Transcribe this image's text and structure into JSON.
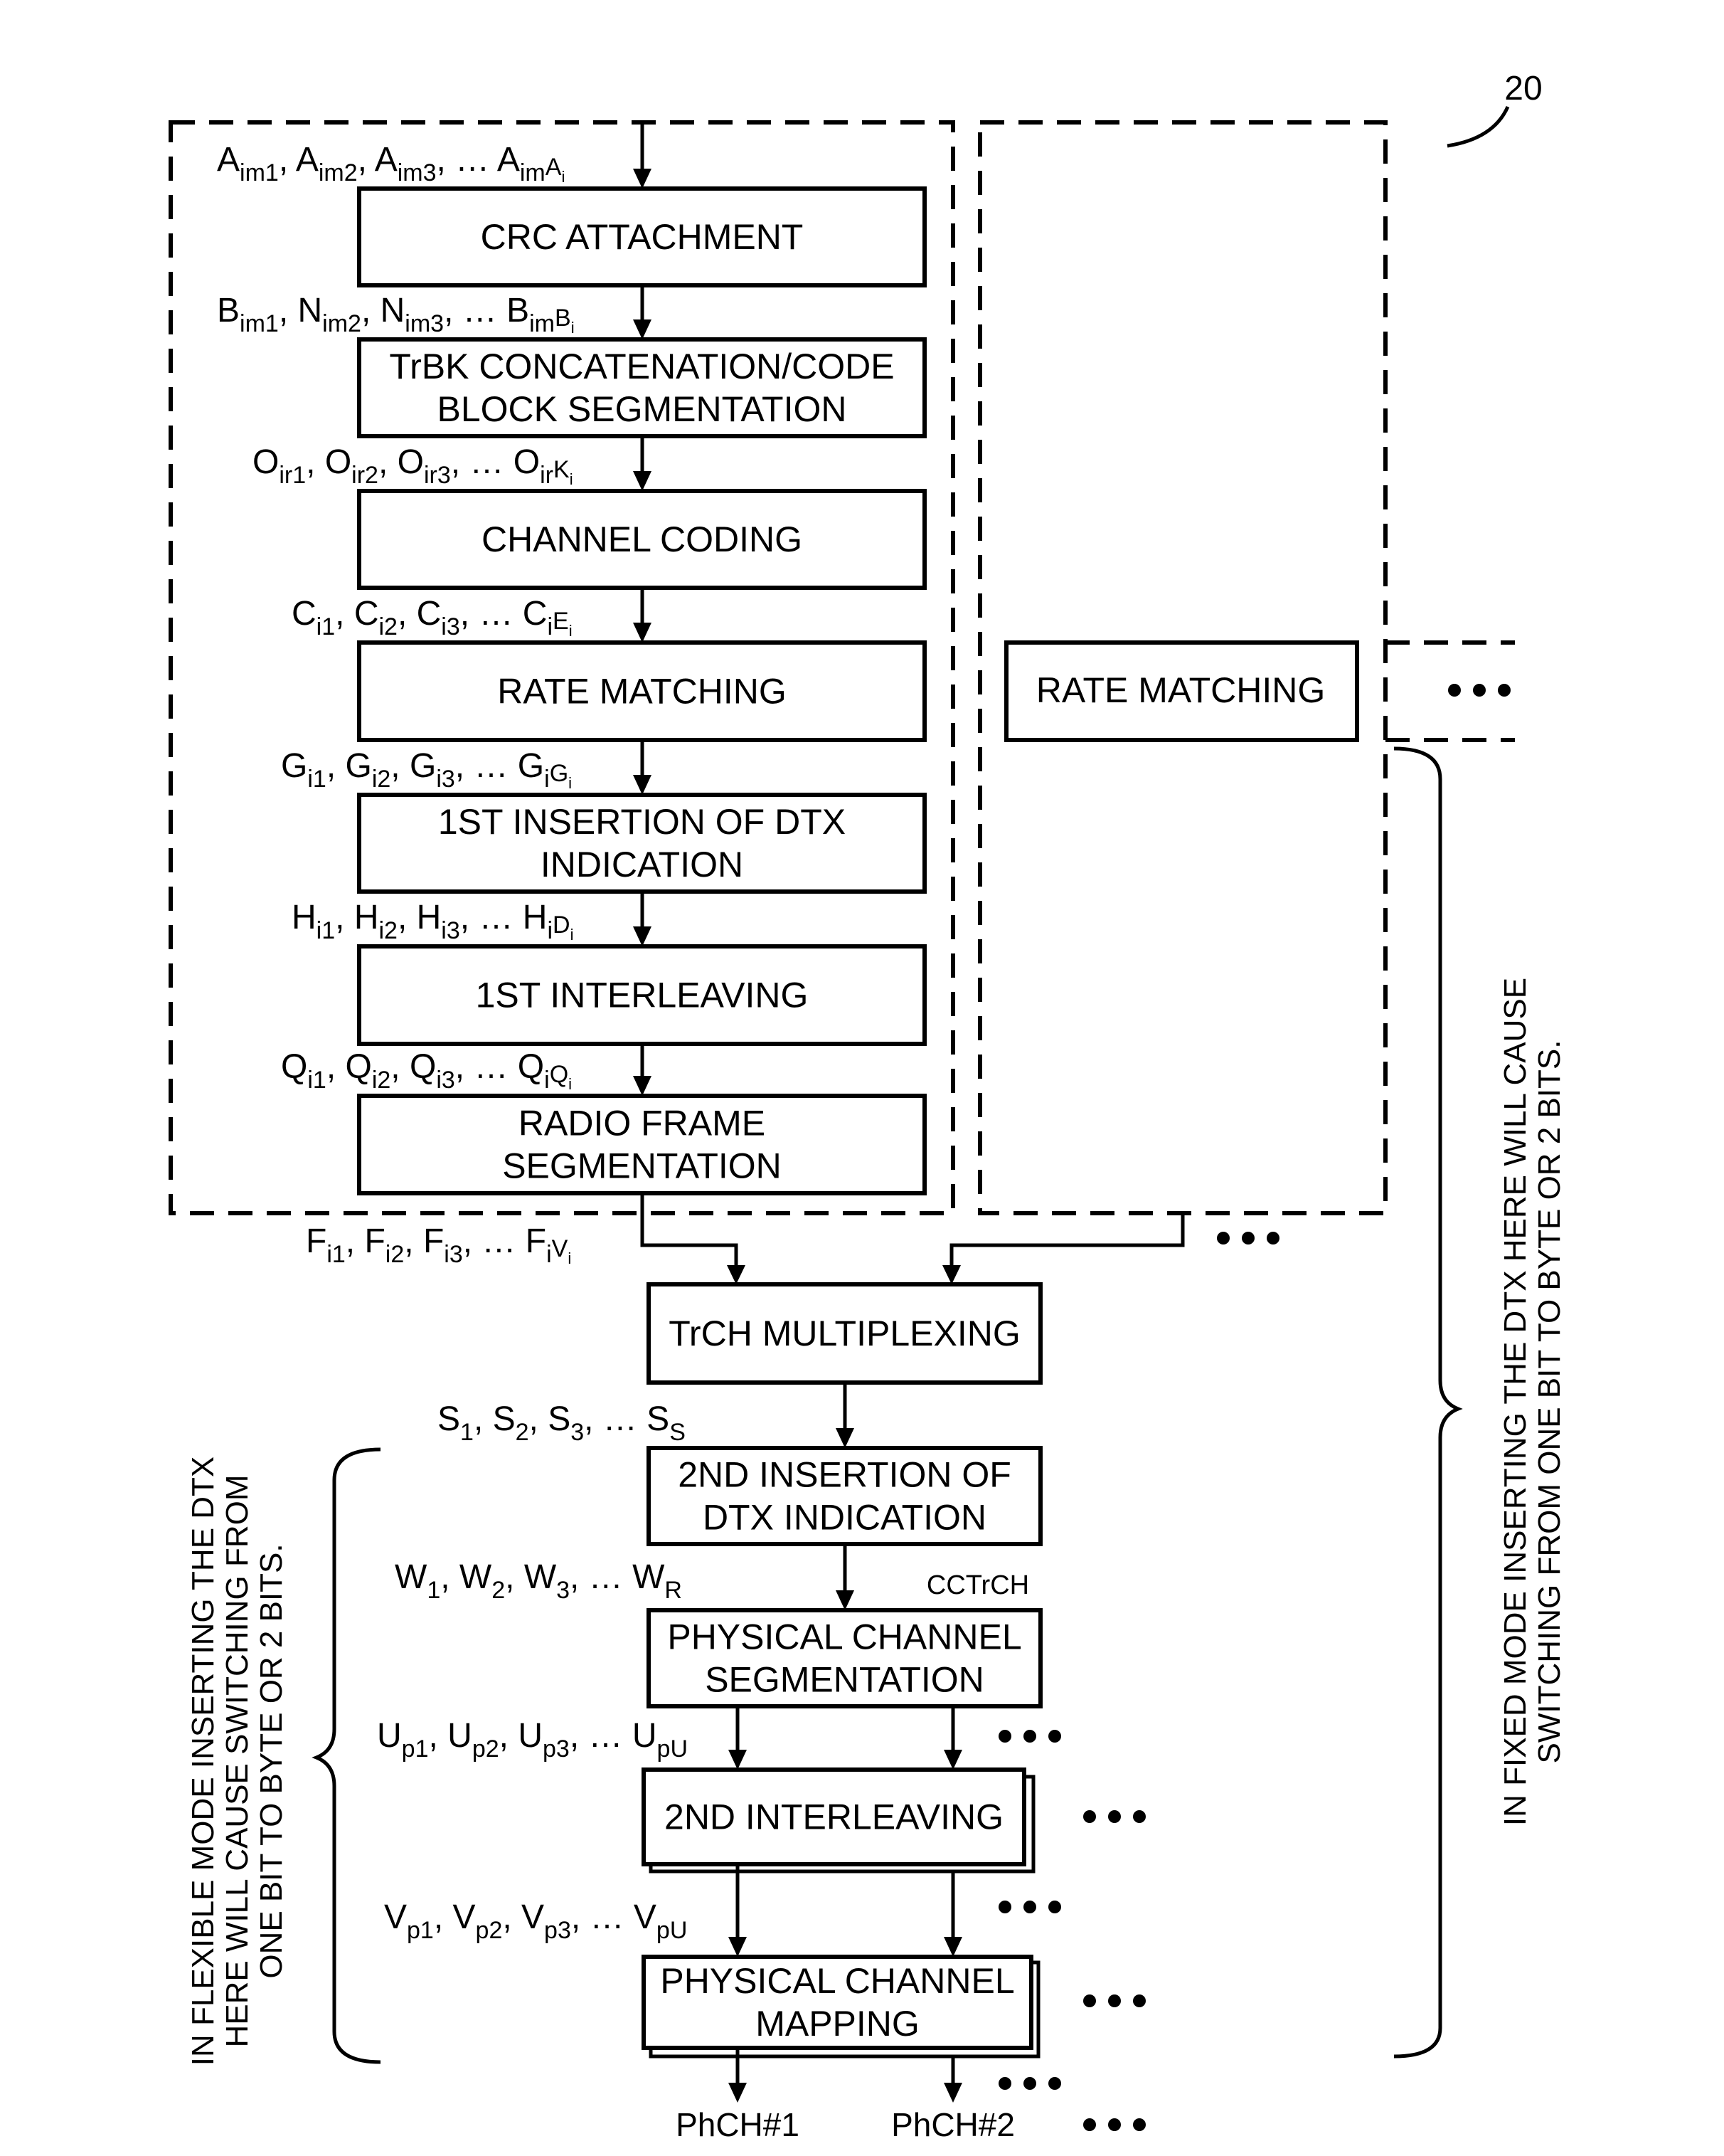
{
  "figure": {
    "reference_number": "20"
  },
  "transport_channel_chain": {
    "blocks": [
      {
        "id": "crc",
        "lines": [
          "CRC ATTACHMENT"
        ]
      },
      {
        "id": "trbk",
        "lines": [
          "TrBK CONCATENATION/CODE",
          "BLOCK SEGMENTATION"
        ]
      },
      {
        "id": "coding",
        "lines": [
          "CHANNEL CODING"
        ]
      },
      {
        "id": "rate",
        "lines": [
          "RATE MATCHING"
        ]
      },
      {
        "id": "dtx1",
        "lines": [
          "1ST INSERTION OF DTX",
          "INDICATION"
        ]
      },
      {
        "id": "il1",
        "lines": [
          "1ST INTERLEAVING"
        ]
      },
      {
        "id": "rfs",
        "lines": [
          "RADIO FRAME",
          "SEGMENTATION"
        ]
      }
    ],
    "second_channel_rate_matching": "RATE MATCHING",
    "sequences": [
      {
        "base": "A",
        "subs": [
          "im1",
          "im2",
          "im3"
        ],
        "last_base": "A",
        "last_sub": "im",
        "last_subsub_base": "A",
        "last_subsub": "i"
      },
      {
        "base": "B",
        "items": [
          "B|im1",
          "N|im2",
          "N|im3"
        ],
        "last_base": "B",
        "last_sub": "im",
        "last_subsub_base": "B",
        "last_subsub": "i"
      },
      {
        "base": "O",
        "items": [
          "O|ir1",
          "O|ir2",
          "O|ir3"
        ],
        "last_base": "O",
        "last_sub": "ir",
        "last_subsub_base": "K",
        "last_subsub": "i"
      },
      {
        "base": "C",
        "items": [
          "C|i1",
          "C|i2",
          "C|i3"
        ],
        "last_base": "C",
        "last_sub": "i",
        "last_subsub_base": "E",
        "last_subsub": "i"
      },
      {
        "base": "G",
        "items": [
          "G|i1",
          "G|i2",
          "G|i3"
        ],
        "last_base": "G",
        "last_sub": "i",
        "last_subsub_base": "G",
        "last_subsub": "i"
      },
      {
        "base": "H",
        "items": [
          "H|i1",
          "H|i2",
          "H|i3"
        ],
        "last_base": "H",
        "last_sub": "i",
        "last_subsub_base": "D",
        "last_subsub": "i"
      },
      {
        "base": "Q",
        "items": [
          "Q|i1",
          "Q|i2",
          "Q|i3"
        ],
        "last_base": "Q",
        "last_sub": "i",
        "last_subsub_base": "Q",
        "last_subsub": "i"
      },
      {
        "base": "F",
        "items": [
          "F|i1",
          "F|i2",
          "F|i3"
        ],
        "last_base": "F",
        "last_sub": "i",
        "last_subsub_base": "V",
        "last_subsub": "i"
      }
    ]
  },
  "cctrch_chain": {
    "blocks": [
      {
        "id": "mux",
        "lines": [
          "TrCH MULTIPLEXING"
        ]
      },
      {
        "id": "dtx2",
        "lines": [
          "2ND INSERTION OF",
          "DTX INDICATION"
        ]
      },
      {
        "id": "pcs",
        "lines": [
          "PHYSICAL CHANNEL",
          "SEGMENTATION"
        ]
      },
      {
        "id": "il2",
        "lines": [
          "2ND INTERLEAVING"
        ]
      },
      {
        "id": "pcm",
        "lines": [
          "PHYSICAL CHANNEL",
          "MAPPING"
        ]
      }
    ],
    "cctrch_label": "CCTrCH",
    "sequences": {
      "s": {
        "items": [
          "S|1",
          "S|2",
          "S|3"
        ],
        "last": "S|S"
      },
      "w": {
        "items": [
          "W|1",
          "W|2",
          "W|3"
        ],
        "last": "W|R"
      },
      "u": {
        "items": [
          "U|p1",
          "U|p2",
          "U|p3"
        ],
        "last": "U|pU"
      },
      "v": {
        "items": [
          "V|p1",
          "V|p2",
          "V|p3"
        ],
        "last": "V|pU"
      }
    },
    "outputs": [
      "PhCH#1",
      "PhCH#2"
    ],
    "ellipsis": "…"
  },
  "annotations": {
    "flexible_mode": [
      "IN FLEXIBLE MODE INSERTING THE DTX",
      "HERE WILL CAUSE SWITCHING FROM",
      "ONE BIT TO BYTE OR 2 BITS."
    ],
    "fixed_mode": [
      "IN FIXED MODE INSERTING THE DTX HERE WILL CAUSE",
      "SWITCHING FROM ONE BIT TO BYTE OR 2 BITS."
    ]
  }
}
